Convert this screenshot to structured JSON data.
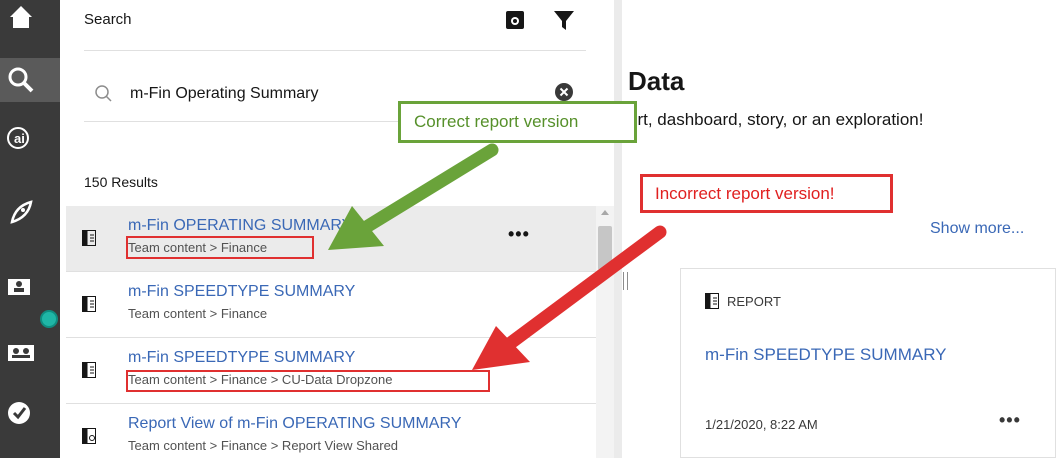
{
  "search_panel": {
    "title": "Search",
    "query": "m-Fin Operating Summary",
    "results_count": "150 Results"
  },
  "results": [
    {
      "title": "m-Fin OPERATING SUMMARY",
      "path": "Team content > Finance",
      "icon": "report-icon",
      "more": "•••"
    },
    {
      "title": "m-Fin SPEEDTYPE SUMMARY",
      "path": "Team content > Finance",
      "icon": "report-icon"
    },
    {
      "title": "m-Fin SPEEDTYPE SUMMARY",
      "path": "Team content > Finance > CU-Data Dropzone",
      "icon": "report-icon"
    },
    {
      "title": "Report View of m-Fin OPERATING SUMMARY",
      "path": "Team content > Finance > Report View Shared",
      "icon": "report-view-icon"
    }
  ],
  "main": {
    "heading": "Data",
    "subtitle": "ort, dashboard, story, or an exploration!",
    "show_more": "Show more..."
  },
  "card": {
    "type": "REPORT",
    "title": "m-Fin SPEEDTYPE SUMMARY",
    "date": "1/21/2020, 8:22 AM",
    "more": "•••"
  },
  "annotations": {
    "correct": "Correct report version",
    "incorrect": "Incorrect report version!",
    "correct_color": "#6aa33a",
    "incorrect_color": "#e03030"
  },
  "rail": {
    "icons": [
      "home-icon",
      "search-icon",
      "ai-icon",
      "rocket-icon",
      "my-content-icon",
      "team-content-icon",
      "checkmark-icon"
    ]
  },
  "colors": {
    "link": "#3a68b6",
    "rail": "#3a3a3a",
    "rail_active": "#5a5a5a"
  }
}
